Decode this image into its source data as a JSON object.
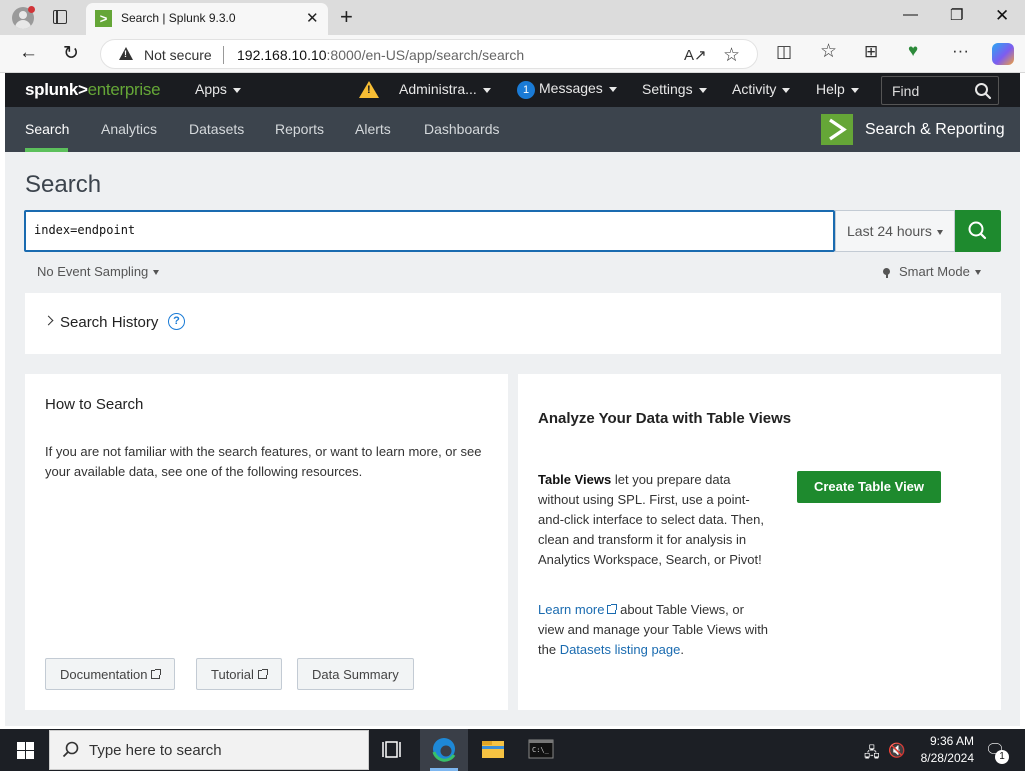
{
  "browser": {
    "tab_title": "Search | Splunk 9.3.0",
    "security_label": "Not secure",
    "url_host": "192.168.10.10",
    "url_rest": ":8000/en-US/app/search/search"
  },
  "splunk_bar": {
    "logo_left": "splunk>",
    "logo_right": "enterprise",
    "apps": "Apps",
    "user": "Administra...",
    "messages_count": "1",
    "messages": "Messages",
    "settings": "Settings",
    "activity": "Activity",
    "help": "Help",
    "find_placeholder": "Find"
  },
  "app_nav": {
    "tabs": [
      "Search",
      "Analytics",
      "Datasets",
      "Reports",
      "Alerts",
      "Dashboards"
    ],
    "app_title": "Search & Reporting"
  },
  "search": {
    "page_title": "Search",
    "query": "index=endpoint",
    "time_range": "Last 24 hours",
    "sampling": "No Event Sampling",
    "mode": "Smart Mode",
    "history_label": "Search History"
  },
  "how_to": {
    "title": "How to Search",
    "body": "If you are not familiar with the search features, or want to learn more, or see your available data, see one of the following resources.",
    "buttons": [
      "Documentation",
      "Tutorial",
      "Data Summary"
    ]
  },
  "table_views": {
    "title": "Analyze Your Data with Table Views",
    "body_bold": "Table Views",
    "body_rest": " let you prepare data without using SPL. First, use a point-and-click interface to select data. Then, clean and transform it for analysis in Analytics Workspace, Search, or Pivot!",
    "learn_more": "Learn more",
    "more_text_1": " about Table Views, or view and manage your Table Views with the ",
    "datasets_link": "Datasets listing page",
    "more_text_2": ".",
    "create_button": "Create Table View"
  },
  "taskbar": {
    "search_placeholder": "Type here to search",
    "time": "9:36 AM",
    "date": "8/28/2024",
    "notification_count": "1"
  },
  "colors": {
    "splunk_green": "#65a637",
    "button_green": "#1e8a2e",
    "link_blue": "#1a6bb0",
    "nav_bg": "#3c444d",
    "bar_bg": "#1a1c20"
  }
}
